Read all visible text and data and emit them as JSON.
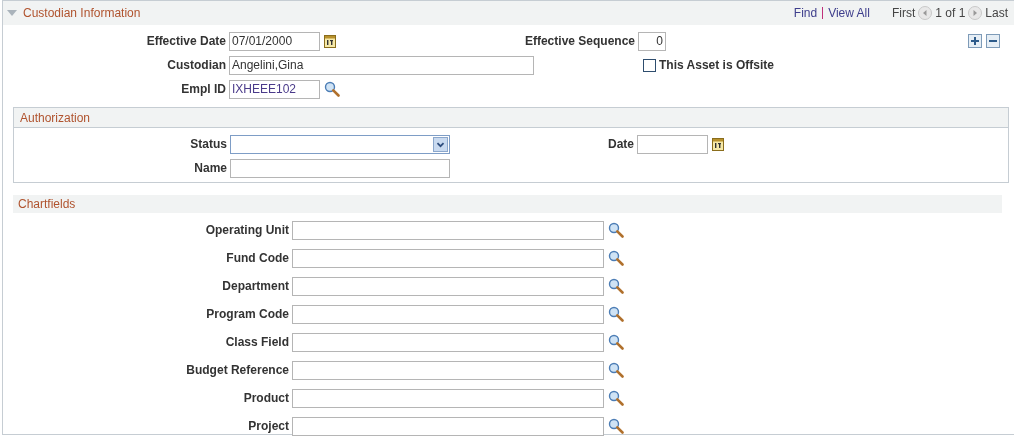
{
  "section": {
    "title": "Custodian Information",
    "expanded": true,
    "links": [
      "Find",
      "View All"
    ],
    "nav": {
      "first": "First",
      "position": "1 of 1",
      "last": "Last"
    }
  },
  "effective_date": {
    "label": "Effective Date",
    "value": "07/01/2000"
  },
  "effective_sequence": {
    "label": "Effective Sequence",
    "value": "0"
  },
  "custodian": {
    "label": "Custodian",
    "value": "Angelini,Gina"
  },
  "offsite": {
    "label": "This Asset is Offsite",
    "checked": false
  },
  "empl_id": {
    "label": "Empl ID",
    "value": "IXHEEE102"
  },
  "authorization": {
    "title": "Authorization",
    "status": {
      "label": "Status"
    },
    "date": {
      "label": "Date"
    },
    "name": {
      "label": "Name"
    }
  },
  "chartfields": {
    "title": "Chartfields",
    "fields": [
      {
        "label": "Operating Unit"
      },
      {
        "label": "Fund Code"
      },
      {
        "label": "Department"
      },
      {
        "label": "Program Code"
      },
      {
        "label": "Class Field"
      },
      {
        "label": "Budget Reference"
      },
      {
        "label": "Product"
      },
      {
        "label": "Project"
      }
    ]
  }
}
